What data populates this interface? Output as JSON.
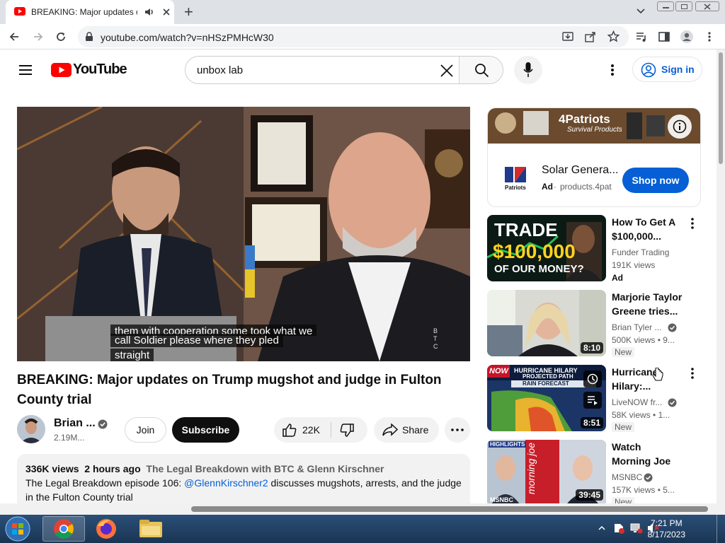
{
  "browser": {
    "tab_title": "BREAKING: Major updates o",
    "url": "youtube.com/watch?v=nHSzPMHcW30",
    "new_tab_symbol": "+"
  },
  "masthead": {
    "logo_text": "YouTube",
    "search_value": "unbox lab",
    "signin_label": "Sign in"
  },
  "video": {
    "captions": [
      "them with cooperation some took what we",
      "call Soldier please where they pled",
      "straight"
    ],
    "watermark": "BTC",
    "title": "BREAKING: Major updates on Trump mugshot and judge in Fulton County trial",
    "channel_name": "Brian ...",
    "subscribers": "2.19M...",
    "join_label": "Join",
    "subscribe_label": "Subscribe",
    "likes": "22K",
    "share_label": "Share",
    "views": "336K views",
    "time_ago": "2 hours ago",
    "hashtag_line": "The Legal Breakdown with BTC & Glenn Kirschner",
    "description_prefix": "The Legal Breakdown episode 106: ",
    "description_mention": "@GlennKirschner2",
    "description_suffix": " discusses mugshots, arrests, and the judge",
    "description_line2": "in the Fulton County trial"
  },
  "ad": {
    "banner_brand": "4Patriots",
    "banner_sub": "Survival Products",
    "logo_text": "Patriots",
    "title": "Solar Genera...",
    "ad_label": "Ad",
    "domain": "products.4pat",
    "cta": "Shop now"
  },
  "recommendations": [
    {
      "title": "How To Get A $100,000...",
      "channel": "Funder Trading",
      "views": "191K views",
      "badge": "Ad",
      "thumb_text_1": "TRADE",
      "thumb_text_2": "$100,000",
      "thumb_text_3": "OF OUR MONEY?"
    },
    {
      "title": "Marjorie Taylor Greene tries...",
      "channel": "Brian Tyler ...",
      "views": "500K views",
      "extra": "9...",
      "badge": "New",
      "duration": "8:10"
    },
    {
      "title": "Hurricane Hilary:...",
      "channel": "LiveNOW fr...",
      "views": "58K views",
      "extra": "1...",
      "badge": "New",
      "duration": "8:51",
      "thumb_text_1": "HURRICANE HILARY",
      "thumb_text_2": "PROJECTED PATH",
      "thumb_text_3": "RAIN FORECAST",
      "thumb_logo": "NOW"
    },
    {
      "title": "Watch Morning Joe Highlight...",
      "channel": "MSNBC",
      "views": "157K views",
      "extra": "5...",
      "badge": "New",
      "duration": "39:45",
      "thumb_text_1": "HIGHLIGHTS",
      "thumb_text_2": "morning joe",
      "thumb_logo": "MSNBC"
    }
  ],
  "taskbar": {
    "time": "7:21 PM",
    "date": "8/17/2023"
  },
  "colors": {
    "youtube_red": "#ff0000",
    "link_blue": "#065fd4",
    "shop_blue": "#065fd4"
  }
}
